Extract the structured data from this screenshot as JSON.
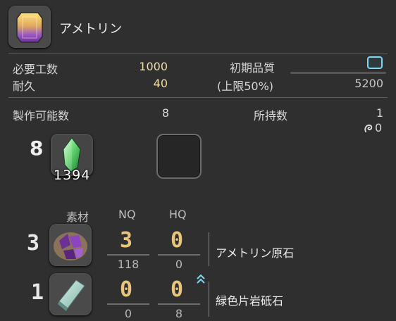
{
  "item": {
    "name": "アメトリン",
    "icon": "ametrine-gem-icon"
  },
  "stats": {
    "required_progress_label": "必要工数",
    "required_progress_value": "1000",
    "durability_label": "耐久",
    "durability_value": "40",
    "initial_quality_label": "初期品質",
    "quality_cap_label": "(上限50%)",
    "quality_cap_value": "5200",
    "quality_box_icon": "empty-toggle-icon"
  },
  "craftable": {
    "label": "製作可能数",
    "value": "8",
    "owned_label": "所持数",
    "owned_value": "1",
    "retainer_icon": "retainer-icon",
    "retainer_value": "0"
  },
  "crystal": {
    "quantity": "8",
    "held": "1394",
    "icon": "wind-crystal-icon"
  },
  "materials": {
    "headers": {
      "material": "素材",
      "nq": "NQ",
      "hq": "HQ"
    },
    "rows": [
      {
        "quantity": "3",
        "nq": "3",
        "hq": "0",
        "nq_held": "118",
        "hq_held": "0",
        "name": "アメトリン原石",
        "icon": "ametrine-ore-icon"
      },
      {
        "quantity": "1",
        "nq": "0",
        "hq": "0",
        "nq_held": "0",
        "hq_held": "8",
        "name": "緑色片岩砥石",
        "icon": "whetstone-icon"
      }
    ]
  },
  "colors": {
    "background": "#2f2f2f",
    "accent": "#7fd8f2",
    "gold": "#f2dfa6"
  }
}
